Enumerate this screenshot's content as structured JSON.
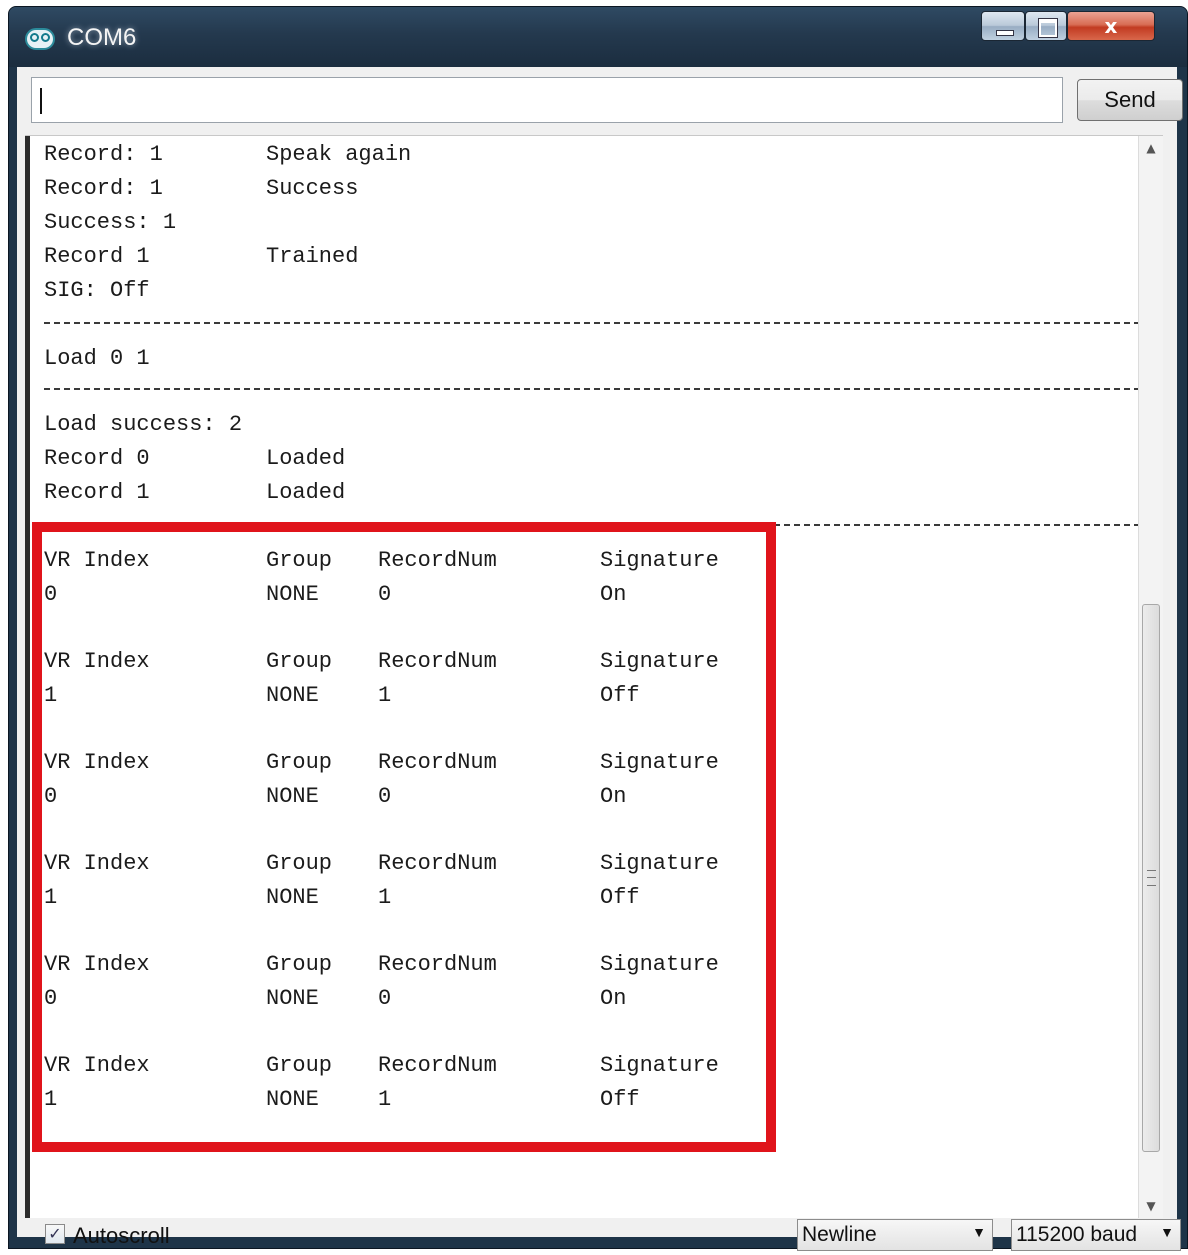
{
  "window": {
    "title": "COM6",
    "close_glyph": "x"
  },
  "input": {
    "value": ""
  },
  "send_label": "Send",
  "console_lines": [
    {
      "a": "Record: 1",
      "b": "Speak again"
    },
    {
      "a": "Record: 1",
      "b": "Success"
    },
    {
      "a": "Success: 1",
      "b": ""
    },
    {
      "a": "Record 1",
      "b": "Trained"
    },
    {
      "a": "SIG: Off",
      "b": ""
    },
    {
      "a": "Load 0 1",
      "b": ""
    },
    {
      "a": "Load success: 2",
      "b": ""
    },
    {
      "a": "Record 0",
      "b": "Loaded"
    },
    {
      "a": "Record 1",
      "b": "Loaded"
    }
  ],
  "table": {
    "headers": [
      "VR Index",
      "Group",
      "RecordNum",
      "Signature"
    ],
    "rows": [
      [
        "0",
        "NONE",
        "0",
        "On"
      ],
      [
        "1",
        "NONE",
        "1",
        "Off"
      ],
      [
        "0",
        "NONE",
        "0",
        "On"
      ],
      [
        "1",
        "NONE",
        "1",
        "Off"
      ],
      [
        "0",
        "NONE",
        "0",
        "On"
      ],
      [
        "1",
        "NONE",
        "1",
        "Off"
      ]
    ]
  },
  "status": {
    "autoscroll_label": "Autoscroll",
    "autoscroll_checked": true,
    "line_ending": "Newline",
    "baud": "115200 baud"
  },
  "colors": {
    "highlight": "#e0141b",
    "titlebar": "#24394e"
  }
}
